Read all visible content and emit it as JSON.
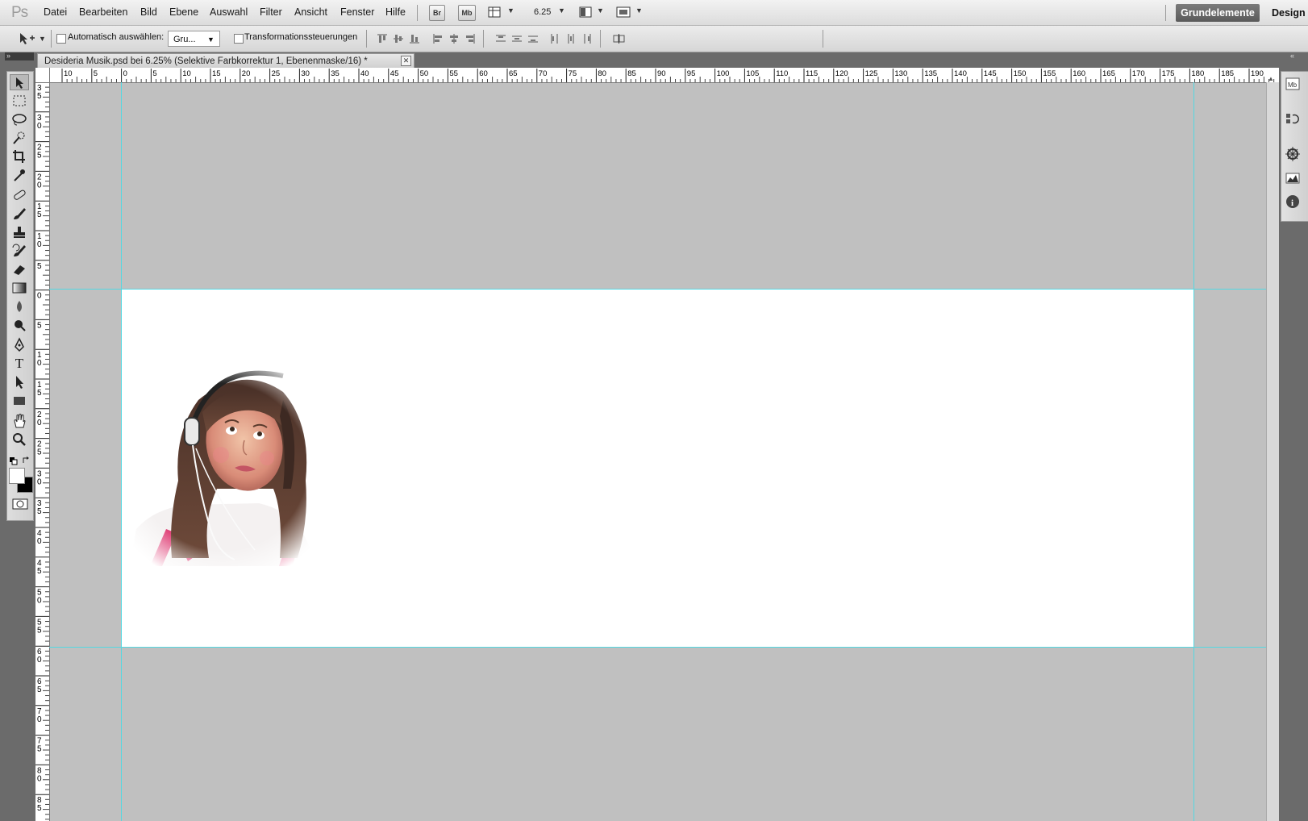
{
  "app": {
    "logo": "Ps"
  },
  "menu": [
    "Datei",
    "Bearbeiten",
    "Bild",
    "Ebene",
    "Auswahl",
    "Filter",
    "Ansicht",
    "Fenster",
    "Hilfe"
  ],
  "appbar": {
    "bridge": "Br",
    "minibridge": "Mb",
    "zoom": "6.25"
  },
  "workspaces": {
    "active": "Grundelemente",
    "other": "Design"
  },
  "options": {
    "auto_select_label": "Automatisch auswählen:",
    "auto_select_value": "Gru...",
    "transform_label": "Transformationssteuerungen"
  },
  "document": {
    "tab_title": "Desideria Musik.psd bei 6.25% (Selektive Farbkorrektur 1, Ebenenmaske/16) *",
    "canvas_color": "#ffffff",
    "pasteboard_color": "#c0c0c0",
    "guide_color": "#54d8e2",
    "image": "photo-girl-with-headphones"
  },
  "ruler_top": [
    "10",
    "5",
    "0",
    "5",
    "10",
    "15",
    "20",
    "25",
    "30",
    "35",
    "40",
    "45",
    "50",
    "55",
    "60",
    "65",
    "70",
    "75",
    "80",
    "85",
    "90",
    "95",
    "100",
    "105",
    "110",
    "115",
    "120",
    "125",
    "130",
    "135",
    "140",
    "145",
    "150",
    "155",
    "160",
    "165",
    "170",
    "175",
    "180",
    "185",
    "190"
  ],
  "ruler_left": [
    [
      "3",
      "5"
    ],
    [
      "3",
      "0"
    ],
    [
      "2",
      "5"
    ],
    [
      "2",
      "0"
    ],
    [
      "1",
      "5"
    ],
    [
      "1",
      "0"
    ],
    [
      "5"
    ],
    [
      "0"
    ],
    [
      "5"
    ],
    [
      "1",
      "0"
    ],
    [
      "1",
      "5"
    ],
    [
      "2",
      "0"
    ],
    [
      "2",
      "5"
    ],
    [
      "3",
      "0"
    ],
    [
      "3",
      "5"
    ],
    [
      "4",
      "0"
    ],
    [
      "4",
      "5"
    ],
    [
      "5",
      "0"
    ],
    [
      "5",
      "5"
    ],
    [
      "6",
      "0"
    ],
    [
      "6",
      "5"
    ],
    [
      "7",
      "0"
    ],
    [
      "7",
      "5"
    ],
    [
      "8",
      "0"
    ],
    [
      "8",
      "5"
    ]
  ],
  "tools": [
    "move-tool-icon",
    "marquee-tool-icon",
    "lasso-tool-icon",
    "quick-selection-tool-icon",
    "crop-tool-icon",
    "eyedropper-tool-icon",
    "healing-brush-tool-icon",
    "brush-tool-icon",
    "clone-stamp-tool-icon",
    "history-brush-tool-icon",
    "eraser-tool-icon",
    "gradient-tool-icon",
    "blur-tool-icon",
    "dodge-tool-icon",
    "pen-tool-icon",
    "type-tool-icon",
    "path-selection-tool-icon",
    "rectangle-tool-icon",
    "hand-tool-icon",
    "zoom-tool-icon"
  ],
  "right_panel_icons": [
    "mini-bridge-icon",
    "history-icon",
    "navigator-icon",
    "histogram-icon",
    "info-icon"
  ]
}
